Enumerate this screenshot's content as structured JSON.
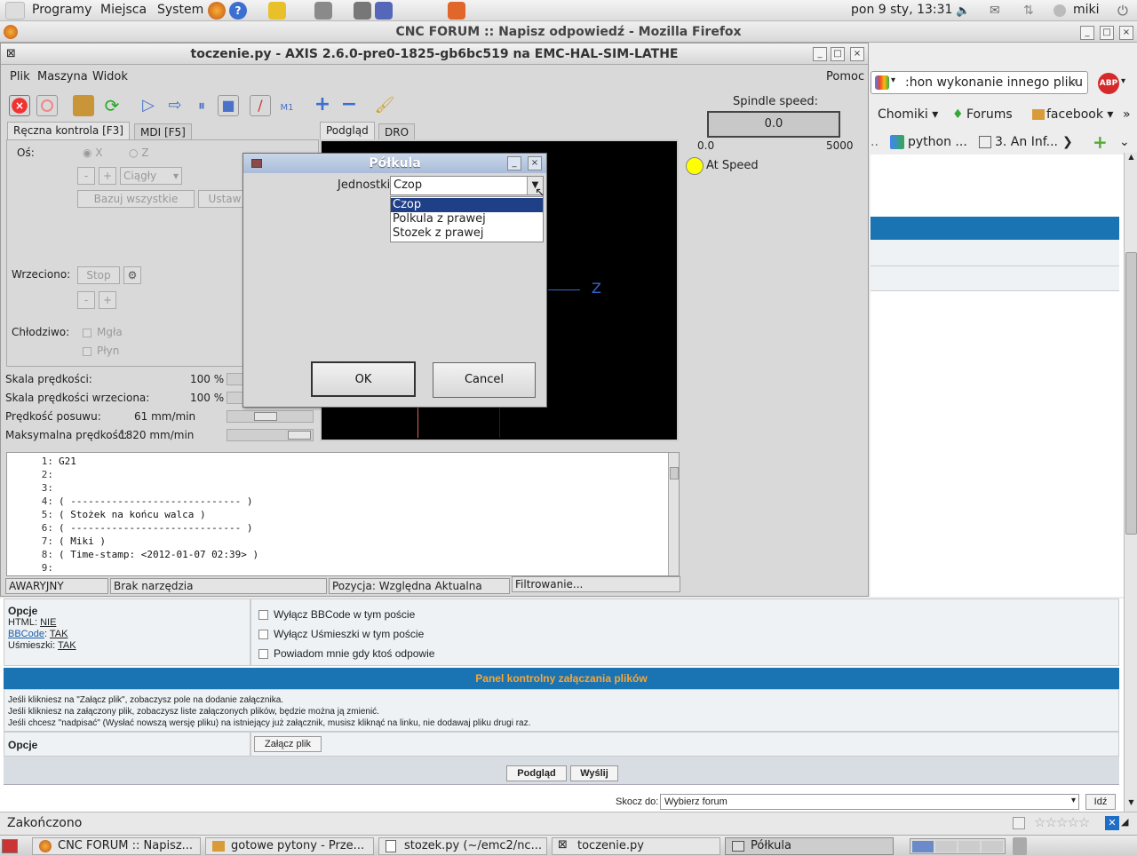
{
  "topbar": {
    "menus": [
      "Programy",
      "Miejsca",
      "System"
    ],
    "datetime": "pon  9 sty, 13:31",
    "user": "miki"
  },
  "firefox": {
    "title": "CNC FORUM :: Napisz odpowiedź - Mozilla Firefox",
    "search_value": ":hon wykonanie innego pliku",
    "bookmarks": [
      "Chomiki",
      "Forums",
      "facebook"
    ],
    "tabs": [
      "python ...",
      "3. An Inf..."
    ]
  },
  "axis": {
    "title": "toczenie.py - AXIS 2.6.0-pre0-1825-gb6bc519 na EMC-HAL-SIM-LATHE",
    "menu": [
      "Plik",
      "Maszyna",
      "Widok"
    ],
    "help": "Pomoc",
    "tabs_left": [
      "Ręczna kontrola [F3]",
      "MDI [F5]"
    ],
    "tabs_right": [
      "Podgląd",
      "DRO"
    ],
    "os_label": "Oś:",
    "axis_x": "X",
    "axis_z": "Z",
    "minus": "-",
    "plus": "+",
    "jog_mode": "Ciągły",
    "home_all": "Bazuj wszystkie",
    "touch_off": "Ustaw",
    "spindle_label": "Wrzeciono:",
    "stop": "Stop",
    "coolant_label": "Chłodziwo:",
    "mist": "Mgła",
    "flood": "Płyn",
    "overrides": [
      {
        "label": "Skala prędkości:",
        "value": "100 %"
      },
      {
        "label": "Skala prędkości wrzeciona:",
        "value": "100 %"
      },
      {
        "label": "Prędkość posuwu:",
        "value": "61 mm/min"
      },
      {
        "label": "Maksymalna prędkość:",
        "value": "1820 mm/min"
      }
    ],
    "spindle_speed_label": "Spindle speed:",
    "spindle_speed": "0.0",
    "scale_min": "0.0",
    "scale_max": "5000",
    "at_speed": "At Speed",
    "preview_z": "Z",
    "gcode": [
      {
        "n": "1:",
        "t": "G21"
      },
      {
        "n": "2:",
        "t": ""
      },
      {
        "n": "3:",
        "t": ""
      },
      {
        "n": "4:",
        "t": "( ----------------------------- )"
      },
      {
        "n": "5:",
        "t": "( Stożek na końcu walca )"
      },
      {
        "n": "6:",
        "t": "( ----------------------------- )"
      },
      {
        "n": "7:",
        "t": "( Miki )"
      },
      {
        "n": "8:",
        "t": "( Time-stamp: <2012-01-07 02:39> )"
      },
      {
        "n": "9:",
        "t": ""
      }
    ],
    "status": [
      "AWARYJNY",
      "Brak narzędzia",
      "Pozycja: Względna Aktualna",
      "Filtrowanie..."
    ]
  },
  "dialog": {
    "title": "Półkula",
    "units_label": "Jednostki",
    "selected": "Czop",
    "options": [
      "Czop",
      "Polkula z prawej",
      "Stozek z prawej"
    ],
    "ok": "OK",
    "cancel": "Cancel"
  },
  "forum": {
    "opcje": "Opcje",
    "html": "HTML:",
    "html_val": "NIE",
    "bbcode": "BBCode",
    "bbcode_val": "TAK",
    "smilies": "Uśmieszki:",
    "smilies_val": "TAK",
    "checks": [
      "Wyłącz BBCode w tym poście",
      "Wyłącz Uśmieszki w tym poście",
      "Powiadom mnie gdy ktoś odpowie"
    ],
    "attach_header": "Panel kontrolny załączania plików",
    "attach_info": [
      "Jeśli klikniesz na \"Załącz plik\", zobaczysz pole na dodanie załącznika.",
      "Jeśli klikniesz na załączony plik, zobaczysz liste załączonych plików, będzie można ją zmienić.",
      "Jeśli chcesz \"nadpisać\" (Wysłać nowszą wersję pliku) na istniejący już załącznik, musisz kliknąć na linku, nie dodawaj pliku drugi raz."
    ],
    "opcje2": "Opcje",
    "attach_btn": "Załącz plik",
    "preview_btn": "Podgląd",
    "send_btn": "Wyślij",
    "jump_label": "Skocz do:",
    "jump_value": "Wybierz forum",
    "go": "Idź"
  },
  "statusbar": "Zakończono",
  "taskbar": [
    "CNC FORUM :: Napisz...",
    "gotowe pytony - Prze...",
    "stozek.py (~/emc2/nc...",
    "toczenie.py",
    "Półkula"
  ]
}
